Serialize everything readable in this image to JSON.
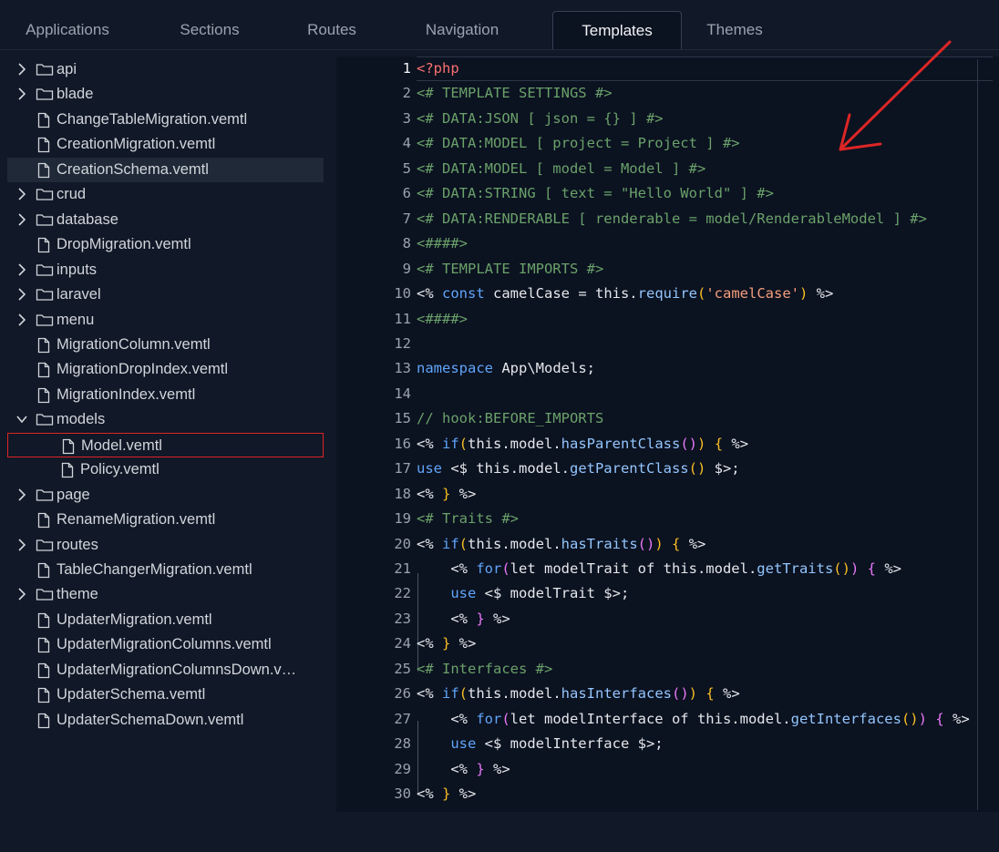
{
  "tabs": [
    {
      "label": "Applications"
    },
    {
      "label": "Sections"
    },
    {
      "label": "Routes"
    },
    {
      "label": "Navigation"
    },
    {
      "label": "Templates",
      "active": true
    },
    {
      "label": "Themes"
    }
  ],
  "tree": [
    {
      "label": "api",
      "type": "folder",
      "depth": 0,
      "expanded": false
    },
    {
      "label": "blade",
      "type": "folder",
      "depth": 0,
      "expanded": false
    },
    {
      "label": "ChangeTableMigration.vemtl",
      "type": "file",
      "depth": 0
    },
    {
      "label": "CreationMigration.vemtl",
      "type": "file",
      "depth": 0
    },
    {
      "label": "CreationSchema.vemtl",
      "type": "file",
      "depth": 0,
      "selected": true
    },
    {
      "label": "crud",
      "type": "folder",
      "depth": 0,
      "expanded": false
    },
    {
      "label": "database",
      "type": "folder",
      "depth": 0,
      "expanded": false
    },
    {
      "label": "DropMigration.vemtl",
      "type": "file",
      "depth": 0
    },
    {
      "label": "inputs",
      "type": "folder",
      "depth": 0,
      "expanded": false
    },
    {
      "label": "laravel",
      "type": "folder",
      "depth": 0,
      "expanded": false
    },
    {
      "label": "menu",
      "type": "folder",
      "depth": 0,
      "expanded": false
    },
    {
      "label": "MigrationColumn.vemtl",
      "type": "file",
      "depth": 0
    },
    {
      "label": "MigrationDropIndex.vemtl",
      "type": "file",
      "depth": 0
    },
    {
      "label": "MigrationIndex.vemtl",
      "type": "file",
      "depth": 0
    },
    {
      "label": "models",
      "type": "folder",
      "depth": 0,
      "expanded": true
    },
    {
      "label": "Model.vemtl",
      "type": "file",
      "depth": 1,
      "active": true
    },
    {
      "label": "Policy.vemtl",
      "type": "file",
      "depth": 1
    },
    {
      "label": "page",
      "type": "folder",
      "depth": 0,
      "expanded": false
    },
    {
      "label": "RenameMigration.vemtl",
      "type": "file",
      "depth": 0
    },
    {
      "label": "routes",
      "type": "folder",
      "depth": 0,
      "expanded": false
    },
    {
      "label": "TableChangerMigration.vemtl",
      "type": "file",
      "depth": 0
    },
    {
      "label": "theme",
      "type": "folder",
      "depth": 0,
      "expanded": false
    },
    {
      "label": "UpdaterMigration.vemtl",
      "type": "file",
      "depth": 0
    },
    {
      "label": "UpdaterMigrationColumns.vemtl",
      "type": "file",
      "depth": 0
    },
    {
      "label": "UpdaterMigrationColumnsDown.v…",
      "type": "file",
      "depth": 0
    },
    {
      "label": "UpdaterSchema.vemtl",
      "type": "file",
      "depth": 0
    },
    {
      "label": "UpdaterSchemaDown.vemtl",
      "type": "file",
      "depth": 0
    }
  ],
  "editor": {
    "current_line": 1,
    "lines": [
      [
        [
          "pk",
          "<?php"
        ]
      ],
      [
        [
          "cm",
          "<# TEMPLATE SETTINGS #>"
        ]
      ],
      [
        [
          "cm",
          "<# DATA:JSON [ json = {} ] #>"
        ]
      ],
      [
        [
          "cm",
          "<# DATA:MODEL [ project = Project ] #>"
        ]
      ],
      [
        [
          "cm",
          "<# DATA:MODEL [ model = Model ] #>"
        ]
      ],
      [
        [
          "cm",
          "<# DATA:STRING [ text = \"Hello World\" ] #>"
        ]
      ],
      [
        [
          "cm",
          "<# DATA:RENDERABLE [ renderable = model/RenderableModel ] #>"
        ]
      ],
      [
        [
          "cm",
          "<####>"
        ]
      ],
      [
        [
          "cm",
          "<# TEMPLATE IMPORTS #>"
        ]
      ],
      [
        [
          "d",
          "<% "
        ],
        [
          "kw",
          "const"
        ],
        [
          "d",
          " camelCase = this."
        ],
        [
          "fn",
          "require"
        ],
        [
          "br",
          "("
        ],
        [
          "st",
          "'camelCase'"
        ],
        [
          "br",
          ")"
        ],
        [
          "d",
          " %>"
        ]
      ],
      [
        [
          "cm",
          "<####>"
        ]
      ],
      [],
      [
        [
          "kw",
          "namespace"
        ],
        [
          "d",
          " App\\Models;"
        ]
      ],
      [],
      [
        [
          "cm",
          "// hook:BEFORE_IMPORTS"
        ]
      ],
      [
        [
          "d",
          "<% "
        ],
        [
          "kw",
          "if"
        ],
        [
          "br",
          "("
        ],
        [
          "d",
          "this.model."
        ],
        [
          "fn",
          "hasParentClass"
        ],
        [
          "br2",
          "()"
        ],
        [
          "br",
          ")"
        ],
        [
          "d",
          " "
        ],
        [
          "br",
          "{"
        ],
        [
          "d",
          " %>"
        ]
      ],
      [
        [
          "kw",
          "use"
        ],
        [
          "d",
          " <$ this.model."
        ],
        [
          "fn",
          "getParentClass"
        ],
        [
          "br",
          "()"
        ],
        [
          "d",
          " $>;"
        ]
      ],
      [
        [
          "d",
          "<% "
        ],
        [
          "br",
          "}"
        ],
        [
          "d",
          " %>"
        ]
      ],
      [
        [
          "cm",
          "<# Traits #>"
        ]
      ],
      [
        [
          "d",
          "<% "
        ],
        [
          "kw",
          "if"
        ],
        [
          "br",
          "("
        ],
        [
          "d",
          "this.model."
        ],
        [
          "fn",
          "hasTraits"
        ],
        [
          "br2",
          "()"
        ],
        [
          "br",
          ")"
        ],
        [
          "d",
          " "
        ],
        [
          "br",
          "{"
        ],
        [
          "d",
          " %>"
        ]
      ],
      [
        [
          "d",
          "    <% "
        ],
        [
          "kw",
          "for"
        ],
        [
          "br2",
          "("
        ],
        [
          "d",
          "let modelTrait of this.model."
        ],
        [
          "fn",
          "getTraits"
        ],
        [
          "br",
          "()"
        ],
        [
          "br2",
          ")"
        ],
        [
          "d",
          " "
        ],
        [
          "br2",
          "{"
        ],
        [
          "d",
          " %>"
        ]
      ],
      [
        [
          "d",
          "    "
        ],
        [
          "kw",
          "use"
        ],
        [
          "d",
          " <$ modelTrait $>;"
        ]
      ],
      [
        [
          "d",
          "    <% "
        ],
        [
          "br2",
          "}"
        ],
        [
          "d",
          " %>"
        ]
      ],
      [
        [
          "d",
          "<% "
        ],
        [
          "br",
          "}"
        ],
        [
          "d",
          " %>"
        ]
      ],
      [
        [
          "cm",
          "<# Interfaces #>"
        ]
      ],
      [
        [
          "d",
          "<% "
        ],
        [
          "kw",
          "if"
        ],
        [
          "br",
          "("
        ],
        [
          "d",
          "this.model."
        ],
        [
          "fn",
          "hasInterfaces"
        ],
        [
          "br2",
          "()"
        ],
        [
          "br",
          ")"
        ],
        [
          "d",
          " "
        ],
        [
          "br",
          "{"
        ],
        [
          "d",
          " %>"
        ]
      ],
      [
        [
          "d",
          "    <% "
        ],
        [
          "kw",
          "for"
        ],
        [
          "br2",
          "("
        ],
        [
          "d",
          "let modelInterface of this.model."
        ],
        [
          "fn",
          "getInterfaces"
        ],
        [
          "br",
          "()"
        ],
        [
          "br2",
          ")"
        ],
        [
          "d",
          " "
        ],
        [
          "br2",
          "{"
        ],
        [
          "d",
          " %>"
        ]
      ],
      [
        [
          "d",
          "    "
        ],
        [
          "kw",
          "use"
        ],
        [
          "d",
          " <$ modelInterface $>;"
        ]
      ],
      [
        [
          "d",
          "    <% "
        ],
        [
          "br2",
          "}"
        ],
        [
          "d",
          " %>"
        ]
      ],
      [
        [
          "d",
          "<% "
        ],
        [
          "br",
          "}"
        ],
        [
          "d",
          " %>"
        ]
      ]
    ]
  },
  "colors": {
    "background": "#111827",
    "editor_background": "#0b1220",
    "active_border": "#dc2626",
    "annotation_arrow": "#dc2626"
  }
}
